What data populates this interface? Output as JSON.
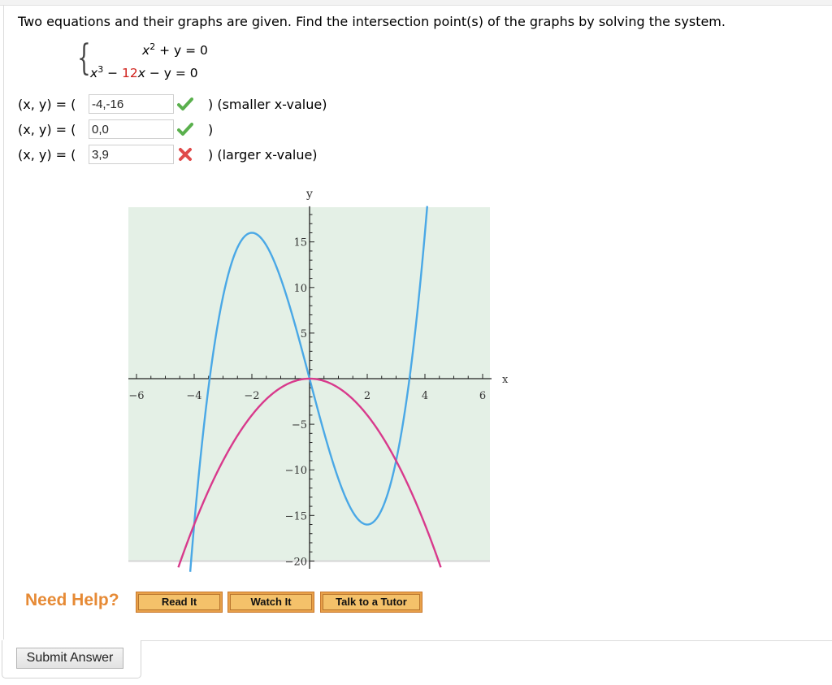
{
  "question": {
    "prompt": "Two equations and their graphs are given. Find the intersection point(s) of the graphs by solving the system.",
    "system": {
      "eq1": {
        "term1": "x",
        "exp1": "2",
        "rest": " + y = 0"
      },
      "eq2": {
        "term1": "x",
        "exp1": "3",
        "minus": " − ",
        "coef": "12",
        "var": "x",
        "rest": " − y = 0"
      }
    }
  },
  "answers": [
    {
      "label": "(x, y) = (",
      "value": "-4,-16",
      "status": "correct",
      "tail": ") (smaller x-value)"
    },
    {
      "label": "(x, y) = (",
      "value": "0,0",
      "status": "correct",
      "tail": ")"
    },
    {
      "label": "(x, y) = (",
      "value": "3,9",
      "status": "incorrect",
      "tail": ") (larger x-value)"
    }
  ],
  "status_icons": {
    "correct": "check-icon",
    "incorrect": "x-icon"
  },
  "colors": {
    "correct": "#5ab04d",
    "incorrect": "#e04a4a",
    "curve_cubic": "#4aa8e6",
    "curve_parabola": "#d83a8c",
    "plot_bg": "#e4f0e6",
    "help_accent": "#e68a35",
    "coef_red": "#d0201a"
  },
  "chart_data": {
    "type": "line",
    "title": "",
    "xlabel": "x",
    "ylabel": "y",
    "xlim": [
      -6.3,
      6.3
    ],
    "ylim": [
      -20.5,
      19
    ],
    "x_ticks": [
      -6,
      -4,
      -2,
      2,
      4,
      6
    ],
    "x_tick_labels": [
      "−6",
      "−4",
      "−2",
      "2",
      "4",
      "6"
    ],
    "y_ticks": [
      -20,
      -15,
      -10,
      -5,
      5,
      10,
      15
    ],
    "y_tick_labels": [
      "−20",
      "−15",
      "−10",
      "−5",
      "5",
      "10",
      "15"
    ],
    "grid": false,
    "series": [
      {
        "name": "y = x^3 - 12x",
        "expr": "cubic",
        "coefficients": [
          1,
          0,
          -12,
          0
        ],
        "x_range": [
          -4.2,
          4.1
        ]
      },
      {
        "name": "y = -x^2",
        "expr": "parabola",
        "coefficients": [
          -1,
          0,
          0
        ],
        "x_range": [
          -4.55,
          4.55
        ]
      }
    ]
  },
  "help": {
    "label": "Need Help?",
    "buttons": [
      "Read It",
      "Watch It",
      "Talk to a Tutor"
    ]
  },
  "submit": {
    "label": "Submit Answer"
  }
}
